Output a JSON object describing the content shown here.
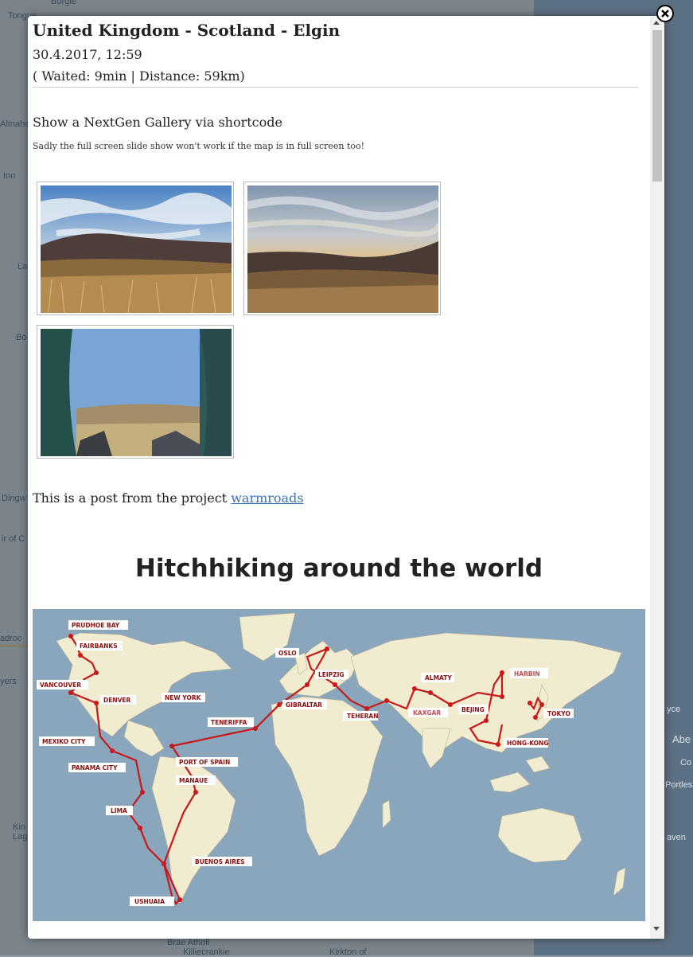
{
  "background_map": {
    "labels": [
      "Tongue",
      "Altnaha",
      "Inn",
      "La",
      "Bo",
      "Dingw",
      "ir of C",
      "adroc",
      "yers",
      "Kin",
      "Lag",
      "Borgie",
      "yce",
      "Abe",
      "Co",
      "Portles",
      "aven",
      "Brae Atholl",
      "Killiecrankie",
      "Kirkton of"
    ]
  },
  "popup": {
    "close_icon": "close-icon",
    "title": "United Kingdom - Scotland - Elgin",
    "datetime": "30.4.2017, 12:59",
    "stats": "( Waited: 9min | Distance: 59km)",
    "gallery_heading": "Show a NextGen Gallery via shortcode",
    "gallery_note": "Sadly the full screen slide show won't work if the map is in full screen too!",
    "gallery_images": [
      "hills-cloudy-sky",
      "hills-sunset",
      "tent-view"
    ],
    "project_text": "This is a post from the project ",
    "project_link": "warmroads",
    "map_heading": "Hitchhiking around the world",
    "map_labels": [
      "PRUDHOE BAY",
      "FAIRBANKS",
      "VANCOUVER",
      "DENVER",
      "NEW YORK",
      "MEXIKO CITY",
      "PANAMA CITY",
      "LIMA",
      "PORT OF SPAIN",
      "MANAUE",
      "BUENOS AIRES",
      "USHUAIA",
      "TENERIFFA",
      "GIBRALTAR",
      "OSLO",
      "LEIPZIG",
      "TEHERAN",
      "KAXGAR",
      "ALMATY",
      "BEJING",
      "HARBIN",
      "TOKYO",
      "HONG-KONG"
    ],
    "colors": {
      "route": "#c81818",
      "ocean": "#8aa6bd",
      "land": "#f1ebcf",
      "link": "#3b72b5"
    }
  }
}
